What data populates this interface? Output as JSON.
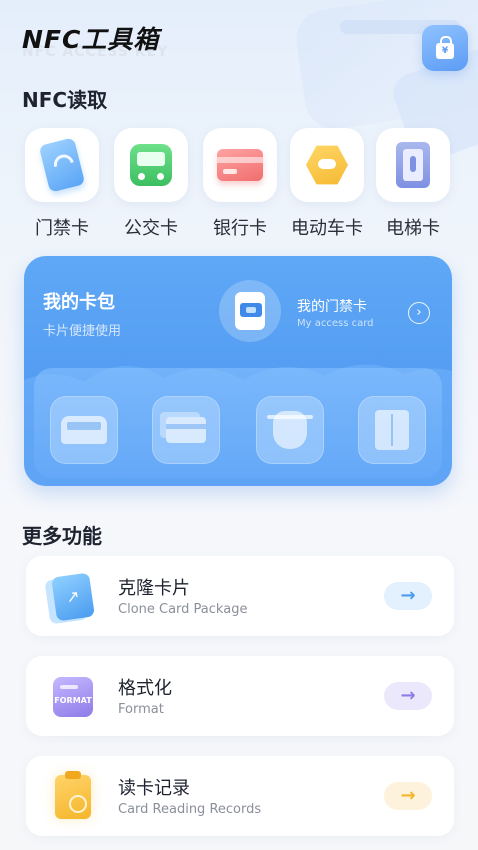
{
  "header": {
    "app_title": "NFC工具箱",
    "app_subtitle": "NFC ACCESS KEY",
    "wallet_symbol": "¥"
  },
  "nfc_section": {
    "title": "NFC读取",
    "items": [
      {
        "label": "门禁卡",
        "icon": "access-card-icon"
      },
      {
        "label": "公交卡",
        "icon": "bus-icon"
      },
      {
        "label": "银行卡",
        "icon": "bank-card-icon"
      },
      {
        "label": "电动车卡",
        "icon": "ebike-icon"
      },
      {
        "label": "电梯卡",
        "icon": "elevator-icon"
      }
    ]
  },
  "wallet": {
    "title": "我的卡包",
    "subtitle": "卡片便捷使用",
    "access_card_name": "我的门禁卡",
    "access_card_en": "My access card",
    "arrow": "›",
    "slots": [
      "bus-card-icon",
      "bank-card-icon",
      "scooter-card-icon",
      "elevator-card-icon"
    ]
  },
  "more_section": {
    "title": "更多功能",
    "items": [
      {
        "title": "克隆卡片",
        "subtitle": "Clone Card Package",
        "arrow": "→",
        "icon_text": "↗",
        "accent": "#4a9cf0",
        "accent_bg": "#e3f0fd"
      },
      {
        "title": "格式化",
        "subtitle": "Format",
        "arrow": "→",
        "icon_text": "FORMAT",
        "accent": "#8f7be8",
        "accent_bg": "#ece8fb"
      },
      {
        "title": "读卡记录",
        "subtitle": "Card Reading Records",
        "arrow": "→",
        "accent": "#f5b52a",
        "accent_bg": "#fdf3dc"
      }
    ]
  },
  "colors": {
    "wallet_card": "#4a93ef",
    "background": "#f4f7fb"
  }
}
